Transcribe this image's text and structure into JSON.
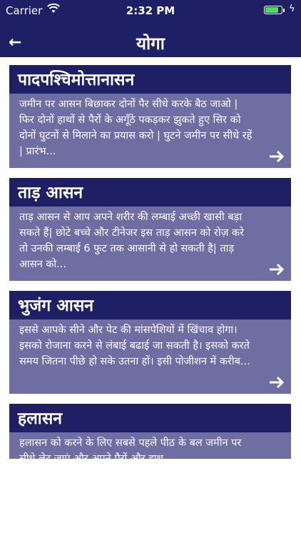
{
  "status_bar": {
    "carrier": "Carrier",
    "time": "2:32 PM",
    "battery_level": 0.9,
    "battery_color": "#4cd964"
  },
  "header": {
    "title": "योगा",
    "back_icon": "back-arrow-icon",
    "background": "#1f1f66"
  },
  "cards": [
    {
      "title": "पादपश्चिमोत्तानासन",
      "description": "जमीन पर आसन बिछाकर दोनों पैर सीधे करके बैठ जाओ | फिर दोनों हाथों से पैरों के अगूँठे पकड़कर झुकते हुए सिर को दोनों घुटनों से मिलाने का प्रयास करो | घुटने जमीन पर सीधे रहें | प्रारंभ..."
    },
    {
      "title": "ताड़ आसन",
      "description": "ताड़ आसन  से आप अपने शरीर की लम्बाई अच्छी खासी बड़ा सकते हैं| छोटे बच्चे और टीनेजर इस ताड़ आसन को रोज़ करे तो उनकी लम्बाई 6 फुट तक आसानी से हो सकती है| ताड़ आसन को..."
    },
    {
      "title": "भुजंग आसन",
      "description": "इससे आपके सीने और पेट की मांसपेशियों में खिंचाव होगा।  इसको रोजाना करने से लंबाई बढाई जा सकती है।  इसको करते समय जितना पीछे हो सके उतना हों।  इसी पोजीशन में करीब..."
    },
    {
      "title": "हलासन",
      "description": "हलासन को करने के लिए सबसे पहले पीठ के बल जमीन पर सीधे लेट जाएं और अपने पैरों और हाथ"
    }
  ],
  "colors": {
    "card_header": "#1f1f66",
    "card_body": "#6e6ea2"
  }
}
